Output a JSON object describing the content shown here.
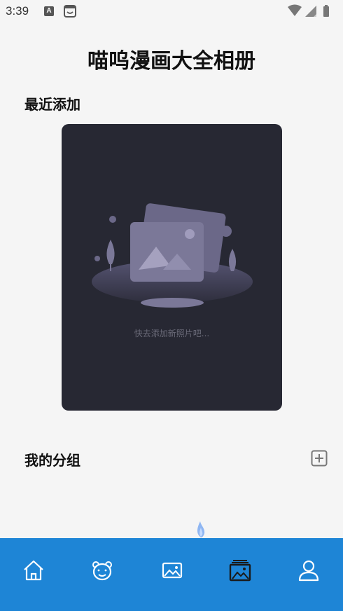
{
  "status_bar": {
    "time": "3:39",
    "notification_a_letter": "A"
  },
  "header": {
    "title": "喵呜漫画大全相册"
  },
  "recent": {
    "title": "最近添加",
    "empty_text": "快去添加新照片吧...",
    "card_color": "#272833"
  },
  "groups": {
    "title": "我的分组",
    "add_icon": "plus-square-icon"
  },
  "bottom_nav": {
    "background": "#1e85d6",
    "items": [
      {
        "icon": "home-icon"
      },
      {
        "icon": "bear-icon"
      },
      {
        "icon": "image-icon"
      },
      {
        "icon": "album-icon",
        "active": true
      },
      {
        "icon": "user-icon"
      }
    ]
  }
}
